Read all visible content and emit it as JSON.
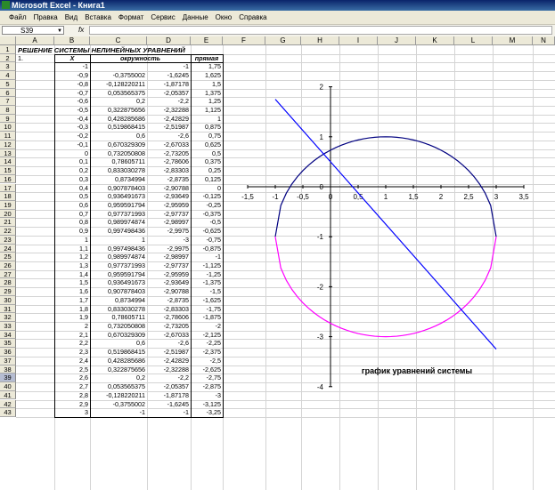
{
  "window": {
    "title": "Microsoft Excel - Книга1"
  },
  "menu": [
    "Файл",
    "Правка",
    "Вид",
    "Вставка",
    "Формат",
    "Сервис",
    "Данные",
    "Окно",
    "Справка"
  ],
  "formula_bar": {
    "name_box": "S39",
    "fx": "fx",
    "value": ""
  },
  "columns": [
    "A",
    "B",
    "C",
    "D",
    "E",
    "F",
    "G",
    "H",
    "I",
    "J",
    "K",
    "L",
    "M",
    "N"
  ],
  "rows": [
    "1",
    "2",
    "3",
    "4",
    "5",
    "6",
    "7",
    "8",
    "9",
    "10",
    "11",
    "12",
    "13",
    "14",
    "15",
    "16",
    "17",
    "18",
    "19",
    "20",
    "21",
    "22",
    "23",
    "24",
    "25",
    "26",
    "27",
    "28",
    "29",
    "30",
    "31",
    "32",
    "33",
    "34",
    "35",
    "36",
    "37",
    "38",
    "39",
    "40",
    "41",
    "42",
    "43"
  ],
  "selected_row": "39",
  "sheet": {
    "title": "РЕШЕНИЕ СИСТЕМЫ НЕЛИНЕЙНЫХ УРАВНЕНИЙ",
    "a2": "1.",
    "headers": {
      "x": "X",
      "circle": "окружность",
      "line": "прямая"
    },
    "rows": [
      [
        "-1",
        "",
        "-1",
        "1,75"
      ],
      [
        "-0,9",
        "-0,3755002",
        "-1,6245",
        "1,625"
      ],
      [
        "-0,8",
        "-0,128220211",
        "-1,87178",
        "1,5"
      ],
      [
        "-0,7",
        "0,053565375",
        "-2,05357",
        "1,375"
      ],
      [
        "-0,6",
        "0,2",
        "-2,2",
        "1,25"
      ],
      [
        "-0,5",
        "0,322875656",
        "-2,32288",
        "1,125"
      ],
      [
        "-0,4",
        "0,428285686",
        "-2,42829",
        "1"
      ],
      [
        "-0,3",
        "0,519868415",
        "-2,51987",
        "0,875"
      ],
      [
        "-0,2",
        "0,6",
        "-2,6",
        "0,75"
      ],
      [
        "-0,1",
        "0,670329309",
        "-2,67033",
        "0,625"
      ],
      [
        "0",
        "0,732050808",
        "-2,73205",
        "0,5"
      ],
      [
        "0,1",
        "0,78605711",
        "-2,78606",
        "0,375"
      ],
      [
        "0,2",
        "0,833030278",
        "-2,83303",
        "0,25"
      ],
      [
        "0,3",
        "0,8734994",
        "-2,8735",
        "0,125"
      ],
      [
        "0,4",
        "0,907878403",
        "-2,90788",
        "0"
      ],
      [
        "0,5",
        "0,936491673",
        "-2,93649",
        "-0,125"
      ],
      [
        "0,6",
        "0,959591794",
        "-2,95959",
        "-0,25"
      ],
      [
        "0,7",
        "0,977371993",
        "-2,97737",
        "-0,375"
      ],
      [
        "0,8",
        "0,989974874",
        "-2,98997",
        "-0,5"
      ],
      [
        "0,9",
        "0,997498436",
        "-2,9975",
        "-0,625"
      ],
      [
        "1",
        "1",
        "-3",
        "-0,75"
      ],
      [
        "1,1",
        "0,997498436",
        "-2,9975",
        "-0,875"
      ],
      [
        "1,2",
        "0,989974874",
        "-2,98997",
        "-1"
      ],
      [
        "1,3",
        "0,977371993",
        "-2,97737",
        "-1,125"
      ],
      [
        "1,4",
        "0,959591794",
        "-2,95959",
        "-1,25"
      ],
      [
        "1,5",
        "0,936491673",
        "-2,93649",
        "-1,375"
      ],
      [
        "1,6",
        "0,907878403",
        "-2,90788",
        "-1,5"
      ],
      [
        "1,7",
        "0,8734994",
        "-2,8735",
        "-1,625"
      ],
      [
        "1,8",
        "0,833030278",
        "-2,83303",
        "-1,75"
      ],
      [
        "1,9",
        "0,78605711",
        "-2,78606",
        "-1,875"
      ],
      [
        "2",
        "0,732050808",
        "-2,73205",
        "-2"
      ],
      [
        "2,1",
        "0,670329309",
        "-2,67033",
        "-2,125"
      ],
      [
        "2,2",
        "0,6",
        "-2,6",
        "-2,25"
      ],
      [
        "2,3",
        "0,519868415",
        "-2,51987",
        "-2,375"
      ],
      [
        "2,4",
        "0,428285686",
        "-2,42829",
        "-2,5"
      ],
      [
        "2,5",
        "0,322875656",
        "-2,32288",
        "-2,625"
      ],
      [
        "2,6",
        "0,2",
        "-2,2",
        "-2,75"
      ],
      [
        "2,7",
        "0,053565375",
        "-2,05357",
        "-2,875"
      ],
      [
        "2,8",
        "-0,128220211",
        "-1,87178",
        "-3"
      ],
      [
        "2,9",
        "-0,3755002",
        "-1,6245",
        "-3,125"
      ],
      [
        "3",
        "-1",
        "-1",
        "-3,25"
      ]
    ]
  },
  "chart_data": {
    "type": "scatter",
    "title": "график уравнений системы",
    "xlim": [
      -1.5,
      3.5
    ],
    "ylim": [
      -4,
      2
    ],
    "xticks": [
      "-1,5",
      "-1",
      "-0,5",
      "0",
      "0,5",
      "1",
      "1,5",
      "2",
      "2,5",
      "3",
      "3,5"
    ],
    "yticks": [
      "2",
      "1",
      "0",
      "-1",
      "-2",
      "-3",
      "-4"
    ],
    "colors": {
      "circle_upper": "#000080",
      "circle_lower": "#ff00ff",
      "line": "#0000ff"
    },
    "circle_upper": {
      "x": [
        -1,
        -0.9,
        -0.8,
        -0.7,
        -0.6,
        -0.5,
        -0.4,
        -0.3,
        -0.2,
        -0.1,
        0,
        0.1,
        0.2,
        0.3,
        0.4,
        0.5,
        0.6,
        0.7,
        0.8,
        0.9,
        1,
        1.1,
        1.2,
        1.3,
        1.4,
        1.5,
        1.6,
        1.7,
        1.8,
        1.9,
        2,
        2.1,
        2.2,
        2.3,
        2.4,
        2.5,
        2.6,
        2.7,
        2.8,
        2.9,
        3
      ],
      "y": [
        -1,
        -0.3755,
        -0.12822,
        0.05357,
        0.2,
        0.32288,
        0.42829,
        0.51987,
        0.6,
        0.67033,
        0.73205,
        0.78606,
        0.83303,
        0.8735,
        0.90788,
        0.93649,
        0.95959,
        0.97737,
        0.98997,
        0.9975,
        1,
        0.9975,
        0.98997,
        0.97737,
        0.95959,
        0.93649,
        0.90788,
        0.8735,
        0.83303,
        0.78606,
        0.73205,
        0.67033,
        0.6,
        0.51987,
        0.42829,
        0.32288,
        0.2,
        0.05357,
        -0.12822,
        -0.3755,
        -1
      ]
    },
    "circle_lower": {
      "x": [
        -1,
        -0.9,
        -0.8,
        -0.7,
        -0.6,
        -0.5,
        -0.4,
        -0.3,
        -0.2,
        -0.1,
        0,
        0.1,
        0.2,
        0.3,
        0.4,
        0.5,
        0.6,
        0.7,
        0.8,
        0.9,
        1,
        1.1,
        1.2,
        1.3,
        1.4,
        1.5,
        1.6,
        1.7,
        1.8,
        1.9,
        2,
        2.1,
        2.2,
        2.3,
        2.4,
        2.5,
        2.6,
        2.7,
        2.8,
        2.9,
        3
      ],
      "y": [
        -1,
        -1.6245,
        -1.87178,
        -2.05357,
        -2.2,
        -2.32288,
        -2.42829,
        -2.51987,
        -2.6,
        -2.67033,
        -2.73205,
        -2.78606,
        -2.83303,
        -2.8735,
        -2.90788,
        -2.93649,
        -2.95959,
        -2.97737,
        -2.98997,
        -2.9975,
        -3,
        -2.9975,
        -2.98997,
        -2.97737,
        -2.95959,
        -2.93649,
        -2.90788,
        -2.8735,
        -2.83303,
        -2.78606,
        -2.73205,
        -2.67033,
        -2.6,
        -2.51987,
        -2.42829,
        -2.32288,
        -2.2,
        -2.05357,
        -1.87178,
        -1.6245,
        -1
      ]
    },
    "line": {
      "x": [
        -1,
        3
      ],
      "y": [
        1.75,
        -3.25
      ]
    }
  }
}
